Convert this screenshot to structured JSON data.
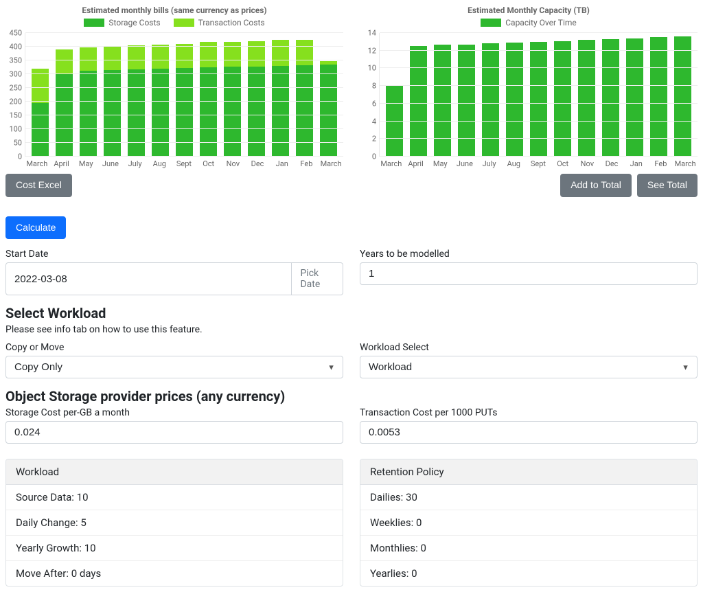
{
  "chart_data": [
    {
      "type": "bar",
      "title": "Estimated monthly bills (same currency as prices)",
      "categories": [
        "March",
        "April",
        "May",
        "June",
        "July",
        "Aug",
        "Sept",
        "Oct",
        "Nov",
        "Dec",
        "Jan",
        "Feb",
        "March"
      ],
      "series": [
        {
          "name": "Storage Costs",
          "color": "#2eb82e",
          "values": [
            195,
            302,
            313,
            315,
            318,
            320,
            322,
            325,
            327,
            328,
            330,
            332,
            335
          ]
        },
        {
          "name": "Transaction Costs",
          "color": "#86e01e",
          "values": [
            125,
            88,
            85,
            85,
            87,
            88,
            88,
            92,
            90,
            93,
            95,
            92,
            13
          ]
        }
      ],
      "ylim": [
        0,
        450
      ],
      "ytick_step": 50,
      "xlabel": "",
      "ylabel": ""
    },
    {
      "type": "bar",
      "title": "Estimated Monthly Capacity (TB)",
      "categories": [
        "March",
        "April",
        "May",
        "June",
        "July",
        "Aug",
        "Sept",
        "Oct",
        "Nov",
        "Dec",
        "Jan",
        "Feb",
        "March"
      ],
      "series": [
        {
          "name": "Capacity Over Time",
          "color": "#2eb82e",
          "values": [
            8.1,
            12.55,
            12.65,
            12.7,
            12.8,
            12.9,
            13.0,
            13.1,
            13.2,
            13.3,
            13.4,
            13.5,
            13.6
          ]
        }
      ],
      "ylim": [
        0,
        14
      ],
      "ytick_step": 2,
      "xlabel": "",
      "ylabel": ""
    }
  ],
  "buttons": {
    "cost_excel": "Cost Excel",
    "add_to_total": "Add to Total",
    "see_total": "See Total",
    "calculate": "Calculate",
    "pick_date": "Pick Date"
  },
  "form": {
    "start_date_label": "Start Date",
    "start_date_value": "2022-03-08",
    "years_label": "Years to be modelled",
    "years_value": "1"
  },
  "workload_section": {
    "heading": "Select Workload",
    "hint": "Please see info tab on how to use this feature.",
    "copy_or_move_label": "Copy or Move",
    "copy_or_move_value": "Copy Only",
    "workload_select_label": "Workload Select",
    "workload_select_value": "Workload"
  },
  "prices_section": {
    "heading": "Object Storage provider prices (any currency)",
    "storage_label": "Storage Cost per-GB a month",
    "storage_value": "0.024",
    "txn_label": "Transaction Cost per 1000 PUTs",
    "txn_value": "0.0053"
  },
  "workload_card": {
    "header": "Workload",
    "source_data_label": "Source Data:",
    "source_data_value": "10",
    "daily_change_label": "Daily Change:",
    "daily_change_value": "5",
    "yearly_growth_label": "Yearly Growth:",
    "yearly_growth_value": "10",
    "move_after_label": "Move After:",
    "move_after_value": "0 days"
  },
  "retention_card": {
    "header": "Retention Policy",
    "dailies_label": "Dailies:",
    "dailies_value": "30",
    "weeklies_label": "Weeklies:",
    "weeklies_value": "0",
    "monthlies_label": "Monthlies:",
    "monthlies_value": "0",
    "yearlies_label": "Yearlies:",
    "yearlies_value": "0"
  }
}
